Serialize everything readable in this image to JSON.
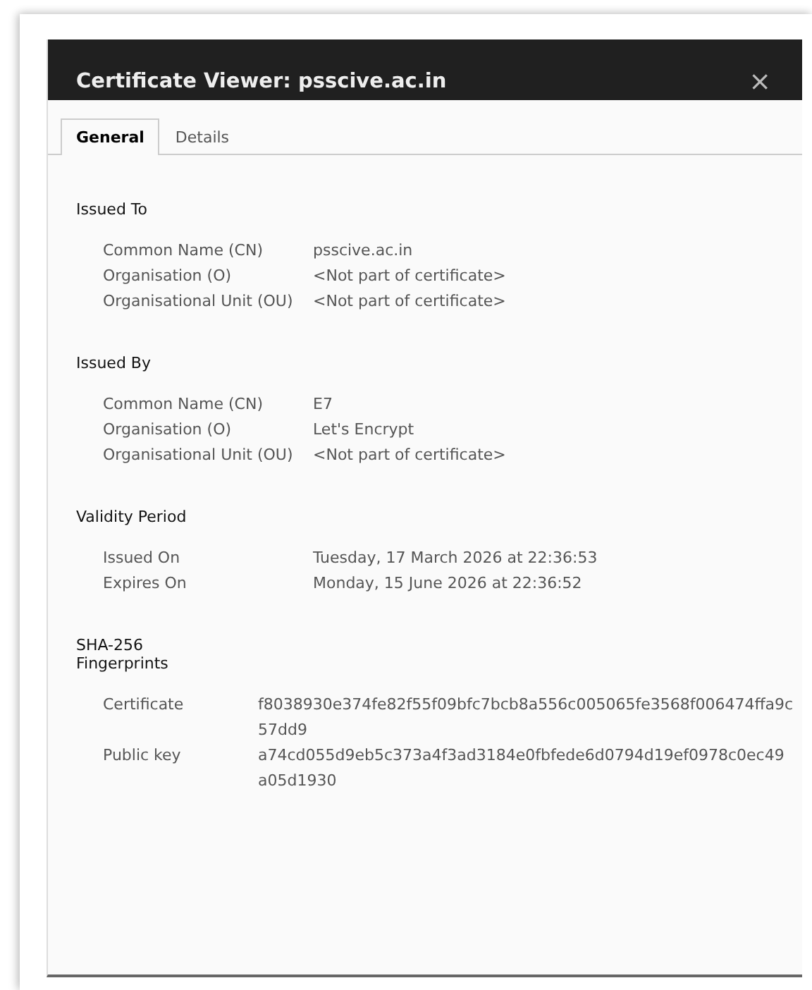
{
  "window": {
    "title": "Certificate Viewer: psscive.ac.in",
    "close": "×"
  },
  "tabs": [
    {
      "label": "General",
      "selected": true
    },
    {
      "label": "Details",
      "selected": false
    }
  ],
  "sections": [
    {
      "heading": "Issued To",
      "kind": "names",
      "fields": [
        {
          "label": "Common Name (CN)",
          "value": "psscive.ac.in"
        },
        {
          "label": "Organisation (O)",
          "value": "<Not part of certificate>"
        },
        {
          "label": "Organisational Unit (OU)",
          "value": "<Not part of certificate>"
        }
      ]
    },
    {
      "heading": "Issued By",
      "kind": "names",
      "fields": [
        {
          "label": "Common Name (CN)",
          "value": "E7"
        },
        {
          "label": "Organisation (O)",
          "value": "Let's Encrypt"
        },
        {
          "label": "Organisational Unit (OU)",
          "value": "<Not part of certificate>"
        }
      ]
    },
    {
      "heading": "Validity Period",
      "kind": "names",
      "fields": [
        {
          "label": "Issued On",
          "value": "Tuesday, 17 March 2026 at 22:36:53"
        },
        {
          "label": "Expires On",
          "value": "Monday, 15 June 2026 at 22:36:52"
        }
      ]
    },
    {
      "heading": "SHA-256 Fingerprints",
      "kind": "hashes",
      "fields": [
        {
          "label": "Certificate",
          "value": "f8038930e374fe82f55f09bfc7bcb8a556c005065fe3568f006474ffa9c57dd9"
        },
        {
          "label": "Public key",
          "value": "a74cd055d9eb5c373a4f3ad3184e0fbfede6d0794d19ef0978c0ec49a05d1930"
        }
      ]
    }
  ]
}
